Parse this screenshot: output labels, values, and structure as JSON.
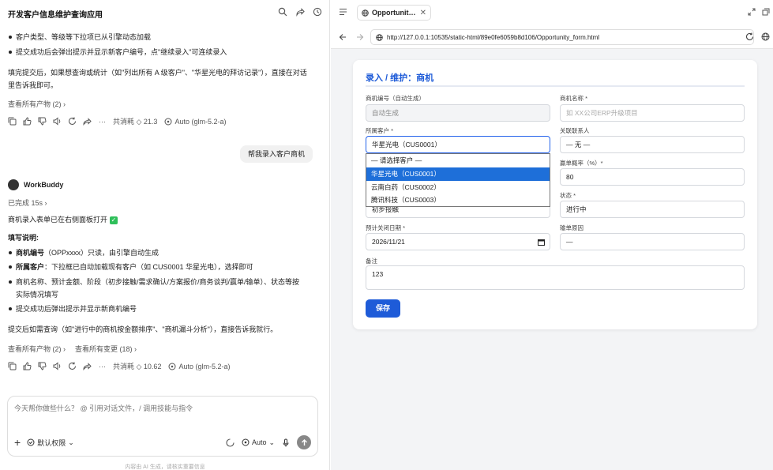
{
  "left": {
    "app_title": "开发客户信息维护查询应用",
    "msg1": {
      "bullets": [
        "客户类型、等级等下拉项已从引擎动态加载",
        "提交成功后会弹出提示并显示新客户编号，点\"继续录入\"可连续录入"
      ],
      "para_line1": "填完提交后，如果想查询或统计（如\"列出所有 A 级客户\"、\"华星光电的拜访记录\"），直接在对话",
      "para_line2": "里告诉我即可。",
      "view_artifacts": "查看所有产物 (2)",
      "cost": "共消耗 ◇ 21.3",
      "model": "Auto (glm-5.2-a)"
    },
    "user_msg": "帮我录入客户商机",
    "bot": {
      "name": "WorkBuddy",
      "done": "已完成 15s",
      "line1": "商机录入表单已在右侧面板打开",
      "instructions_title": "填写说明:",
      "b1_bold": "商机编号",
      "b1_rest": "（OPPxxxx）只读，由引擎自动生成",
      "b2_bold": "所属客户",
      "b2_rest": "：下拉框已自动加载现有客户（如 CUS0001 华星光电），选择即可",
      "b3_line1": "商机名称、预计金额、阶段（初步接触/需求确认/方案报价/商务谈判/赢单/输单）、状态等按",
      "b3_line2": "实际情况填写",
      "b4": "提交成功后弹出提示并显示新商机编号",
      "para": "提交后如需查询（如\"进行中的商机按金额排序\"、\"商机漏斗分析\"），直接告诉我就行。",
      "view_artifacts": "查看所有产物 (2)",
      "view_changes": "查看所有变更 (18)",
      "cost": "共消耗 ◇ 10.62",
      "model": "Auto (glm-5.2-a)"
    },
    "composer": {
      "placeholder": "今天帮你做些什么？ @ 引用对话文件，/ 调用技能与指令",
      "permission": "默认权限",
      "mode": "Auto"
    },
    "footer_note": "内容由 AI 生成，请核实重要信息"
  },
  "right": {
    "tab_label": "Opportunity_...",
    "url": "http://127.0.0.1:10535/static-html/89e0fe6059b8d106/Opportunity_form.html",
    "form": {
      "title": "录入 / 维护：商机",
      "opp_id_label": "商机编号（自动生成）",
      "opp_id_value": "自动生成",
      "opp_name_label": "商机名称 *",
      "opp_name_placeholder": "如 XX公司ERP升级项目",
      "customer_label": "所属客户 *",
      "customer_value": "华星光电（CUS0001）",
      "contact_label": "关联联系人",
      "contact_value": "— 无 —",
      "win_rate_label": "赢单概率（%）*",
      "win_rate_value": "80",
      "stage_value": "初步接触",
      "status_label": "状态 *",
      "status_value": "进行中",
      "close_date_label": "预计关闭日期 *",
      "close_date_value": "2026/11/21",
      "loss_reason_label": "输单原因",
      "loss_reason_value": "—",
      "notes_label": "备注",
      "notes_value": "123",
      "save_label": "保存",
      "dropdown_options": [
        "— 请选择客户 —",
        "华星光电（CUS0001）",
        "云南白药（CUS0002）",
        "腾讯科技（CUS0003）"
      ]
    }
  },
  "colors": {
    "accent": "#1e5bd8",
    "selected_option": "#1e6fd9"
  }
}
